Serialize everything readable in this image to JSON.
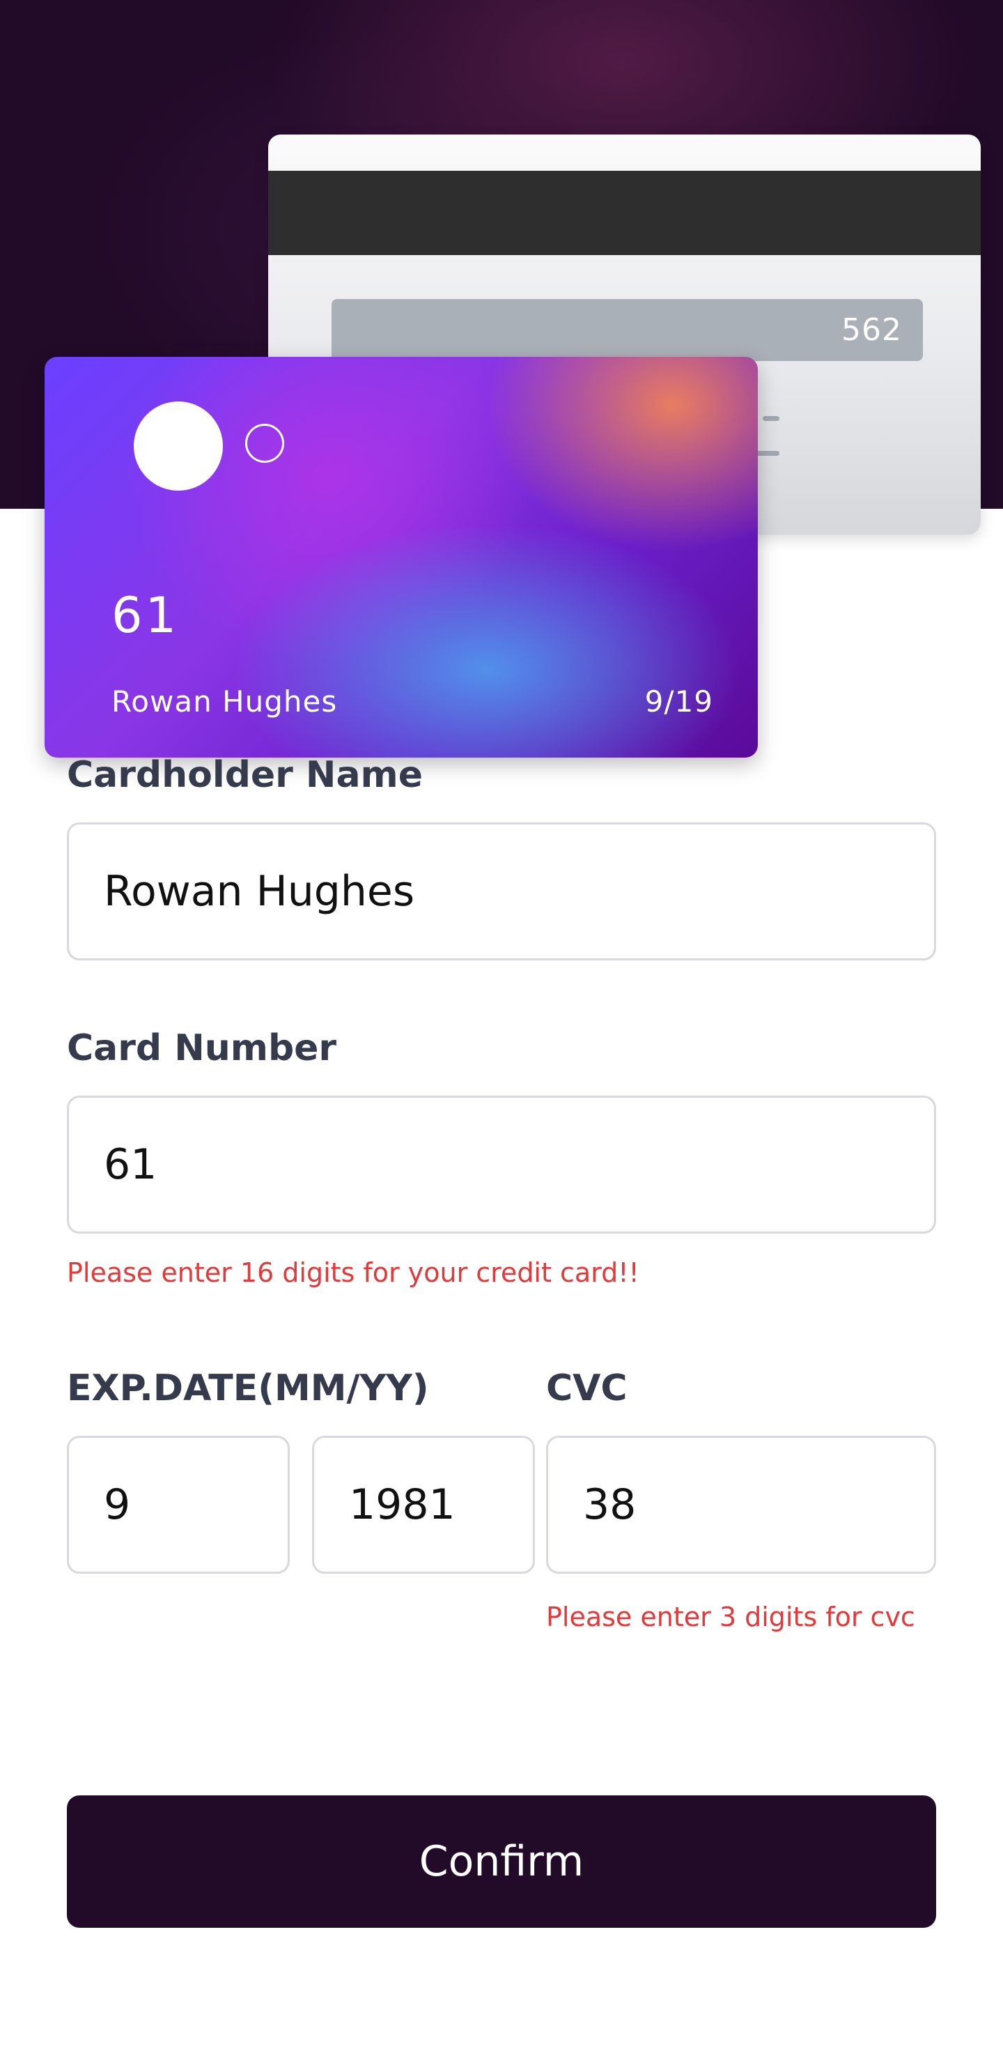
{
  "card_back": {
    "cvc": "562"
  },
  "card_front": {
    "number": "61",
    "holder_name": "Rowan Hughes",
    "expiry": "9/19"
  },
  "form": {
    "cardholder_name_label": "Cardholder Name",
    "cardholder_name_value": "Rowan Hughes",
    "card_number_label": "Card Number",
    "card_number_value": "61",
    "card_number_error": "Please enter 16 digits for your credit card!!",
    "exp_date_label": "EXP.DATE(MM/YY)",
    "exp_month_value": "9",
    "exp_year_value": "1981",
    "cvc_label": "CVC",
    "cvc_value": "38",
    "cvc_error": "Please enter 3 digits for cvc",
    "confirm_label": "Confirm"
  },
  "colors": {
    "hero_background": "#220a29",
    "error_text": "#e03a3a",
    "label_text": "#353b4c",
    "button_background": "#220a29"
  }
}
